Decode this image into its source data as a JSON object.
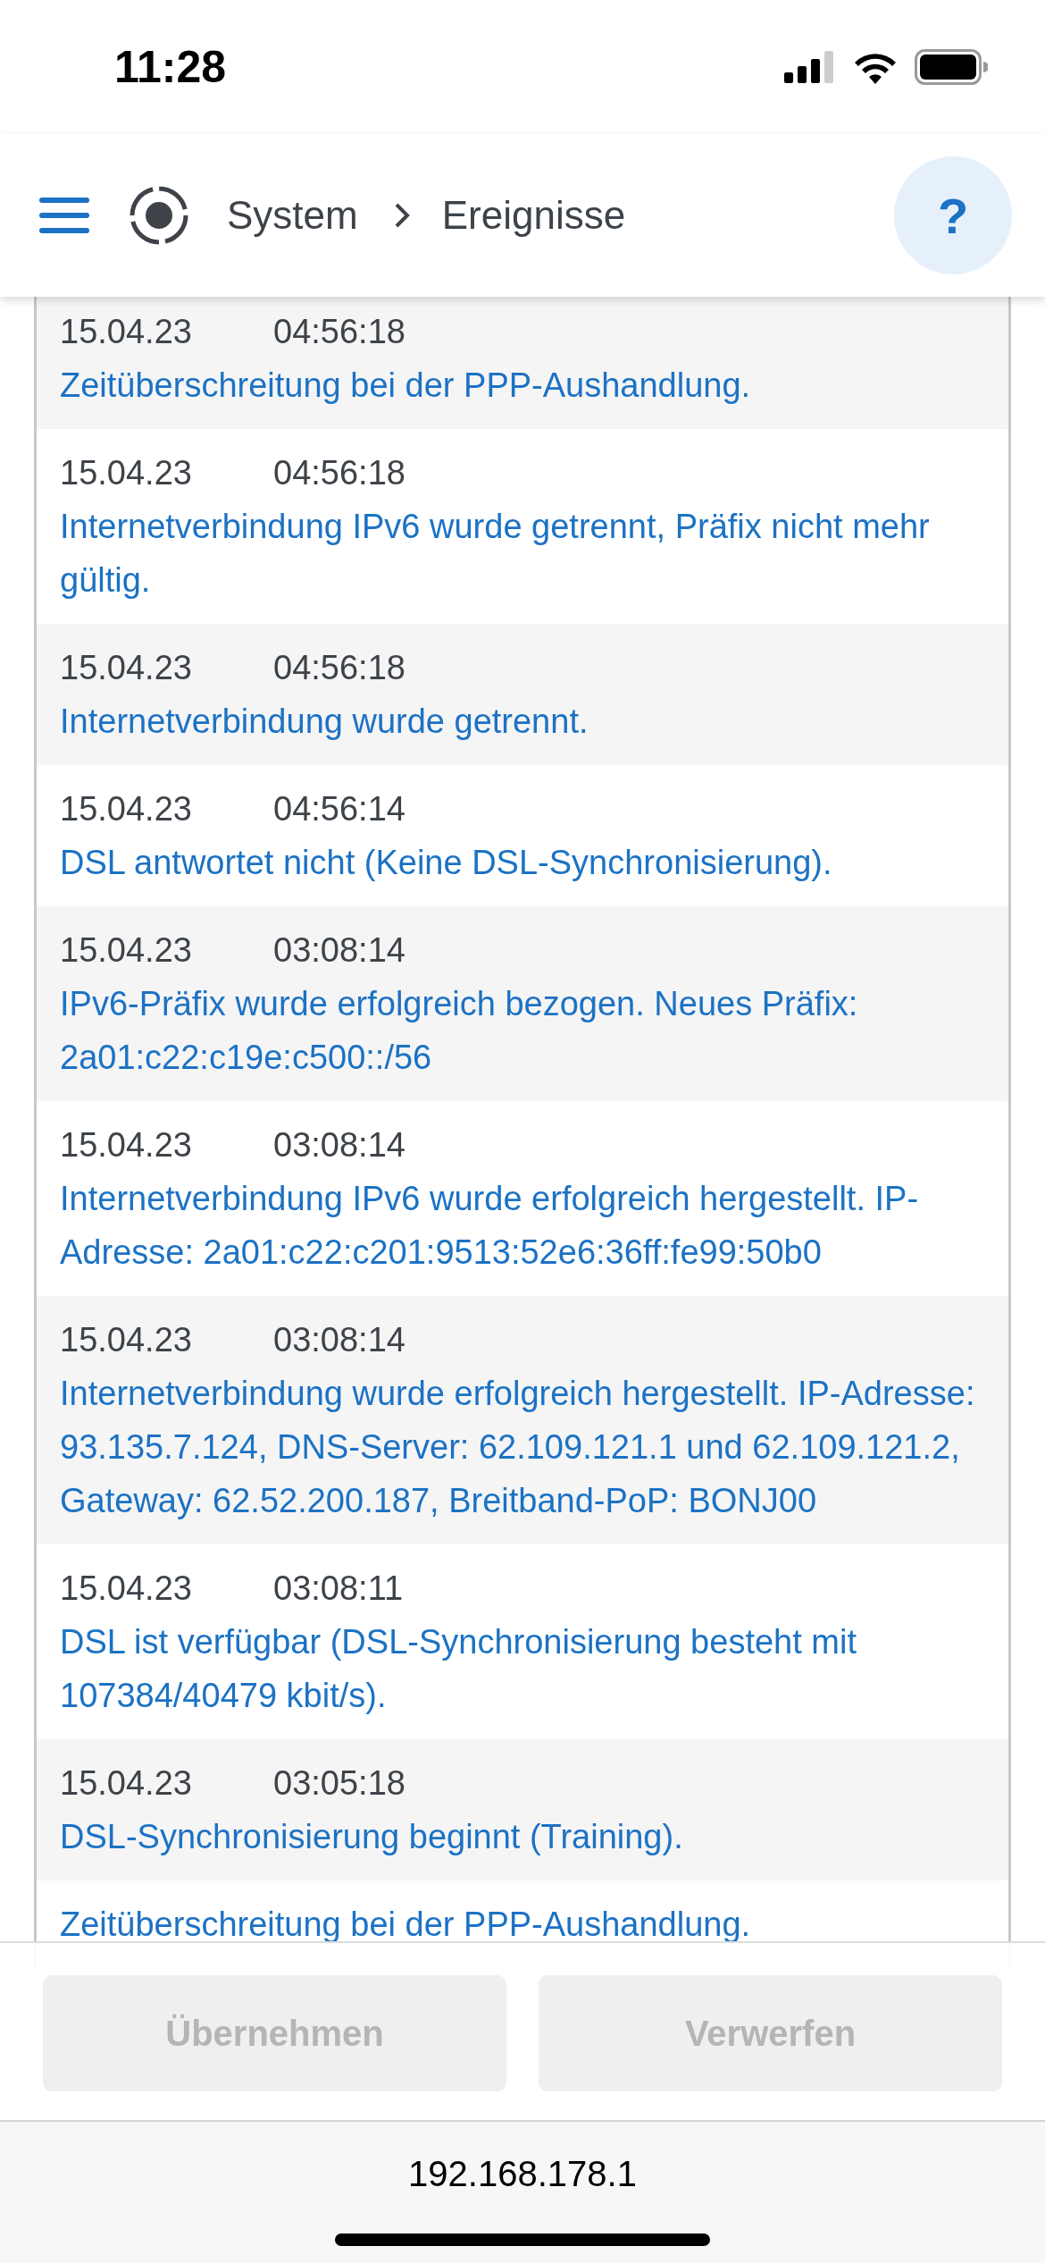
{
  "status_bar": {
    "time": "11:28"
  },
  "header": {
    "breadcrumb": [
      "System",
      "Ereignisse"
    ],
    "help": "?"
  },
  "events": [
    {
      "date": "15.04.23",
      "time": "04:56:18",
      "message": "Zeitüberschreitung bei der PPP-Aushandlung."
    },
    {
      "date": "15.04.23",
      "time": "04:56:18",
      "message": "Internetverbindung IPv6 wurde getrennt, Präfix nicht mehr gültig."
    },
    {
      "date": "15.04.23",
      "time": "04:56:18",
      "message": "Internetverbindung wurde getrennt."
    },
    {
      "date": "15.04.23",
      "time": "04:56:14",
      "message": "DSL antwortet nicht (Keine DSL-Synchronisierung)."
    },
    {
      "date": "15.04.23",
      "time": "03:08:14",
      "message": "IPv6-Präfix wurde erfolgreich bezogen. Neues Präfix: 2a01:c22:c19e:c500::/56"
    },
    {
      "date": "15.04.23",
      "time": "03:08:14",
      "message": "Internetverbindung IPv6 wurde erfolgreich hergestellt. IP-Adresse: 2a01:c22:c201:9513:52e6:36ff:fe99:50b0"
    },
    {
      "date": "15.04.23",
      "time": "03:08:14",
      "message": "Internetverbindung wurde erfolgreich hergestellt. IP-Adresse: 93.135.7.124, DNS-Server: 62.109.121.1 und 62.109.121.2, Gateway: 62.52.200.187, Breitband-PoP: BONJ00"
    },
    {
      "date": "15.04.23",
      "time": "03:08:11",
      "message": "DSL ist verfügbar (DSL-Synchronisierung besteht mit 107384/40479 kbit/s)."
    },
    {
      "date": "15.04.23",
      "time": "03:05:18",
      "message": "DSL-Synchronisierung beginnt (Training)."
    },
    {
      "message": "Zeitüberschreitung bei der PPP-Aushandlung."
    }
  ],
  "buttons": [
    {
      "label": "Übernehmen",
      "disabled": true
    },
    {
      "label": "Verwerfen",
      "disabled": true
    }
  ],
  "url_bar": {
    "address": "192.168.178.1"
  }
}
